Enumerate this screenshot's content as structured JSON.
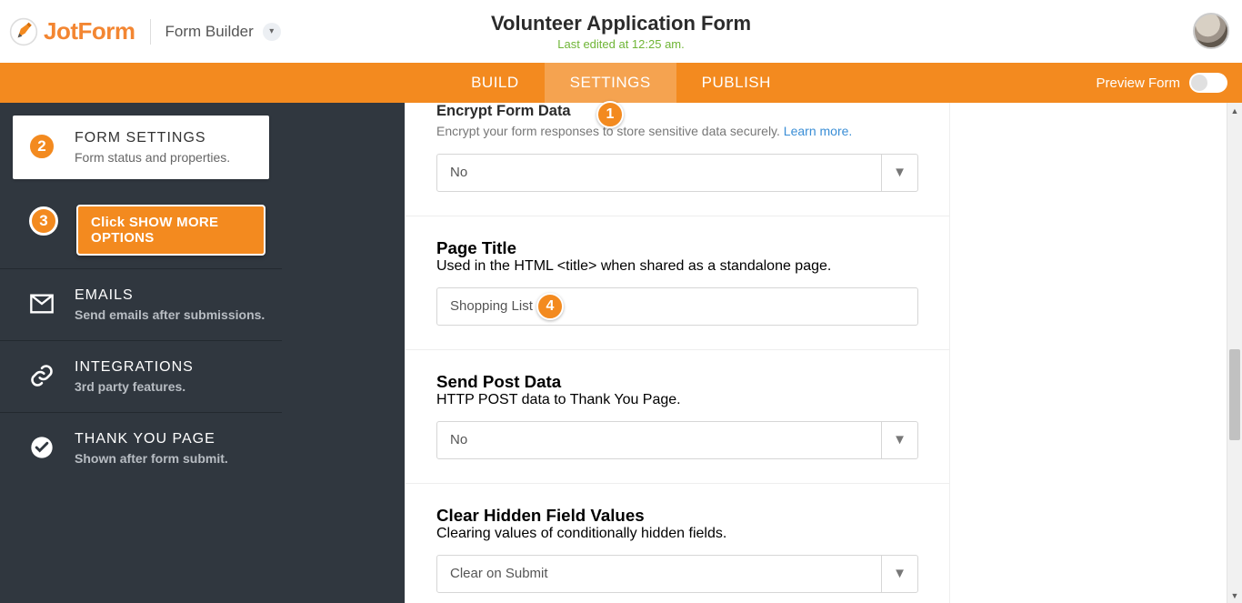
{
  "header": {
    "brand": "JotForm",
    "breadcrumb": "Form Builder",
    "title": "Volunteer Application Form",
    "subtitle": "Last edited at 12:25 am."
  },
  "nav": {
    "tabs": [
      "BUILD",
      "SETTINGS",
      "PUBLISH"
    ],
    "active_index": 1,
    "preview_label": "Preview Form"
  },
  "sidebar": {
    "items": [
      {
        "title": "FORM SETTINGS",
        "desc": "Form status and properties."
      },
      {
        "title": "Click SHOW MORE OPTIONS"
      },
      {
        "title": "EMAILS",
        "desc": "Send emails after submissions."
      },
      {
        "title": "INTEGRATIONS",
        "desc": "3rd party features."
      },
      {
        "title": "THANK YOU PAGE",
        "desc": "Shown after form submit."
      }
    ]
  },
  "settings": {
    "encrypt": {
      "title": "Encrypt Form Data",
      "desc_a": "Encrypt your form responses to store sensitive data securely. ",
      "link": "Learn more.",
      "value": "No"
    },
    "page_title": {
      "title": "Page Title",
      "desc": "Used in the HTML <title> when shared as a standalone page.",
      "value": "Shopping List"
    },
    "post_data": {
      "title": "Send Post Data",
      "desc": "HTTP POST data to Thank You Page.",
      "value": "No"
    },
    "clear_hidden": {
      "title": "Clear Hidden Field Values",
      "desc": "Clearing values of conditionally hidden fields.",
      "value": "Clear on Submit"
    }
  },
  "annotations": {
    "a1": "1",
    "a2": "2",
    "a3": "3",
    "a4": "4"
  }
}
